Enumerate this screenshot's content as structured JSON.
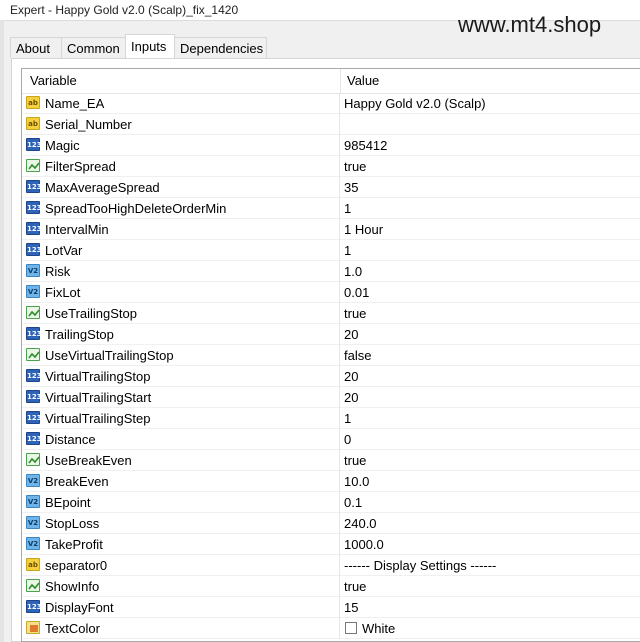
{
  "window": {
    "title": "Expert - Happy Gold v2.0 (Scalp)_fix_1420"
  },
  "watermark": "www.mt4.shop",
  "tabs": [
    {
      "label": "About",
      "active": false
    },
    {
      "label": "Common",
      "active": false
    },
    {
      "label": "Inputs",
      "active": true
    },
    {
      "label": "Dependencies",
      "active": false
    }
  ],
  "table": {
    "headers": {
      "variable": "Variable",
      "value": "Value"
    },
    "rows": [
      {
        "icon": "ab",
        "name": "Name_EA",
        "value": "Happy Gold v2.0 (Scalp)"
      },
      {
        "icon": "ab",
        "name": "Serial_Number",
        "value": ""
      },
      {
        "icon": "123",
        "name": "Magic",
        "value": "985412"
      },
      {
        "icon": "bool",
        "name": "FilterSpread",
        "value": "true"
      },
      {
        "icon": "123",
        "name": "MaxAverageSpread",
        "value": "35"
      },
      {
        "icon": "123",
        "name": "SpreadTooHighDeleteOrderMin",
        "value": "1"
      },
      {
        "icon": "123",
        "name": "IntervalMin",
        "value": "1 Hour"
      },
      {
        "icon": "123",
        "name": "LotVar",
        "value": "1"
      },
      {
        "icon": "v2",
        "name": "Risk",
        "value": "1.0"
      },
      {
        "icon": "v2",
        "name": "FixLot",
        "value": "0.01"
      },
      {
        "icon": "bool",
        "name": "UseTrailingStop",
        "value": "true"
      },
      {
        "icon": "123",
        "name": "TrailingStop",
        "value": "20"
      },
      {
        "icon": "bool",
        "name": "UseVirtualTrailingStop",
        "value": "false"
      },
      {
        "icon": "123",
        "name": "VirtualTrailingStop",
        "value": "20"
      },
      {
        "icon": "123",
        "name": "VirtualTrailingStart",
        "value": "20"
      },
      {
        "icon": "123",
        "name": "VirtualTrailingStep",
        "value": "1"
      },
      {
        "icon": "123",
        "name": "Distance",
        "value": "0"
      },
      {
        "icon": "bool",
        "name": "UseBreakEven",
        "value": "true"
      },
      {
        "icon": "v2",
        "name": "BreakEven",
        "value": "10.0"
      },
      {
        "icon": "v2",
        "name": "BEpoint",
        "value": "0.1"
      },
      {
        "icon": "v2",
        "name": "StopLoss",
        "value": "240.0"
      },
      {
        "icon": "v2",
        "name": "TakeProfit",
        "value": "1000.0"
      },
      {
        "icon": "ab",
        "name": "separator0",
        "value": "------ Display Settings ------"
      },
      {
        "icon": "bool",
        "name": "ShowInfo",
        "value": "true"
      },
      {
        "icon": "123",
        "name": "DisplayFont",
        "value": "15"
      },
      {
        "icon": "color",
        "name": "TextColor",
        "value": "White",
        "swatch": "#ffffff"
      }
    ]
  }
}
